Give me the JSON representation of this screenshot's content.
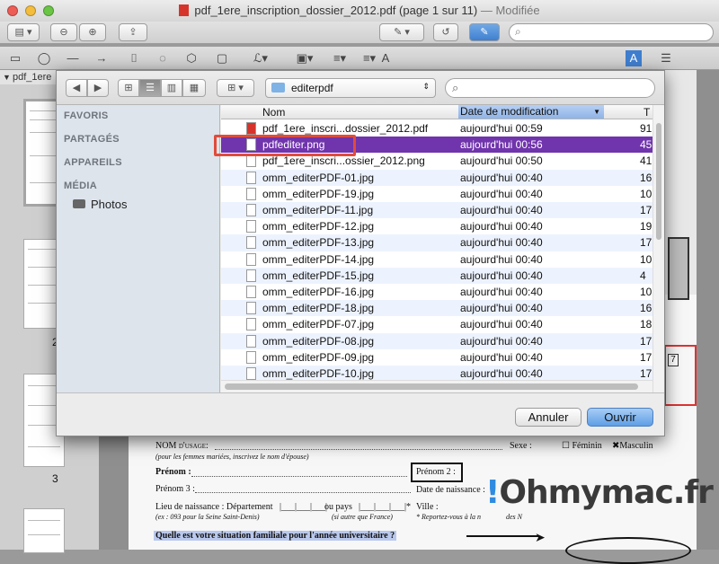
{
  "window": {
    "title": "pdf_1ere_inscription_dossier_2012.pdf (page 1 sur 11)",
    "title_suffix": "— Modifiée"
  },
  "sidebar": {
    "header": "pdf_1ere",
    "page_labels": [
      "2",
      "3"
    ]
  },
  "dialog": {
    "location": "editerpdf",
    "search_placeholder": "",
    "sections": [
      "FAVORIS",
      "PARTAGÉS",
      "APPAREILS",
      "MÉDIA"
    ],
    "media_items": [
      {
        "label": "Photos",
        "icon": "camera-icon"
      }
    ],
    "columns": {
      "name": "Nom",
      "date": "Date de modification",
      "size": "T"
    },
    "files": [
      {
        "name": "pdf_1ere_inscri...dossier_2012.pdf",
        "date": "aujourd'hui 00:59",
        "size": "91",
        "icon": "pdf-file-icon"
      },
      {
        "name": "pdfediter.png",
        "date": "aujourd'hui 00:56",
        "size": "45",
        "icon": "png-file-icon",
        "selected": true
      },
      {
        "name": "pdf_1ere_inscri...ossier_2012.png",
        "date": "aujourd'hui 00:50",
        "size": "41",
        "icon": "png-file-icon"
      },
      {
        "name": "omm_editerPDF-01.jpg",
        "date": "aujourd'hui 00:40",
        "size": "16",
        "icon": "jpg-file-icon"
      },
      {
        "name": "omm_editerPDF-19.jpg",
        "date": "aujourd'hui 00:40",
        "size": "10",
        "icon": "jpg-file-icon"
      },
      {
        "name": "omm_editerPDF-11.jpg",
        "date": "aujourd'hui 00:40",
        "size": "17",
        "icon": "jpg-file-icon"
      },
      {
        "name": "omm_editerPDF-12.jpg",
        "date": "aujourd'hui 00:40",
        "size": "19",
        "icon": "jpg-file-icon"
      },
      {
        "name": "omm_editerPDF-13.jpg",
        "date": "aujourd'hui 00:40",
        "size": "17",
        "icon": "jpg-file-icon"
      },
      {
        "name": "omm_editerPDF-14.jpg",
        "date": "aujourd'hui 00:40",
        "size": "10",
        "icon": "jpg-file-icon"
      },
      {
        "name": "omm_editerPDF-15.jpg",
        "date": "aujourd'hui 00:40",
        "size": "4",
        "icon": "jpg-file-icon"
      },
      {
        "name": "omm_editerPDF-16.jpg",
        "date": "aujourd'hui 00:40",
        "size": "10",
        "icon": "jpg-file-icon"
      },
      {
        "name": "omm_editerPDF-18.jpg",
        "date": "aujourd'hui 00:40",
        "size": "16",
        "icon": "jpg-file-icon"
      },
      {
        "name": "omm_editerPDF-07.jpg",
        "date": "aujourd'hui 00:40",
        "size": "18",
        "icon": "jpg-file-icon"
      },
      {
        "name": "omm_editerPDF-08.jpg",
        "date": "aujourd'hui 00:40",
        "size": "17",
        "icon": "jpg-file-icon"
      },
      {
        "name": "omm_editerPDF-09.jpg",
        "date": "aujourd'hui 00:40",
        "size": "17",
        "icon": "jpg-file-icon"
      },
      {
        "name": "omm_editerPDF-10.jpg",
        "date": "aujourd'hui 00:40",
        "size": "17",
        "icon": "jpg-file-icon"
      }
    ],
    "cancel_label": "Annuler",
    "open_label": "Ouvrir"
  },
  "document": {
    "nom_usage": "NOM d'usage:",
    "nom_usage_note": "(pour les femmes mariées, inscrivez le nom d'épouse)",
    "sexe": "Sexe :",
    "feminin": "Féminin",
    "masculin": "Masculin",
    "prenom": "Prénom :",
    "prenom2": "Prénom 2 :",
    "prenom3": "Prénom 3 :",
    "date_naissance": "Date de naissance :",
    "lieu_naissance": "Lieu de naissance : Département",
    "ou_pays": "ou pays",
    "ville": "Ville :",
    "dept_note": "(ex : 093 pour la Seine Saint-Denis)",
    "pays_note": "(si autre que France)",
    "reporter_note": "* Reportez-vous à la n",
    "reporter_note_end": "des N",
    "question": "Quelle est votre situation familiale pour l'année universitaire ?"
  },
  "watermark": {
    "brand": "Ohmymac.fr"
  },
  "colors": {
    "selection": "#7034ac",
    "highlight_box": "#e14b3b",
    "open_button": "#5f9ee6"
  }
}
